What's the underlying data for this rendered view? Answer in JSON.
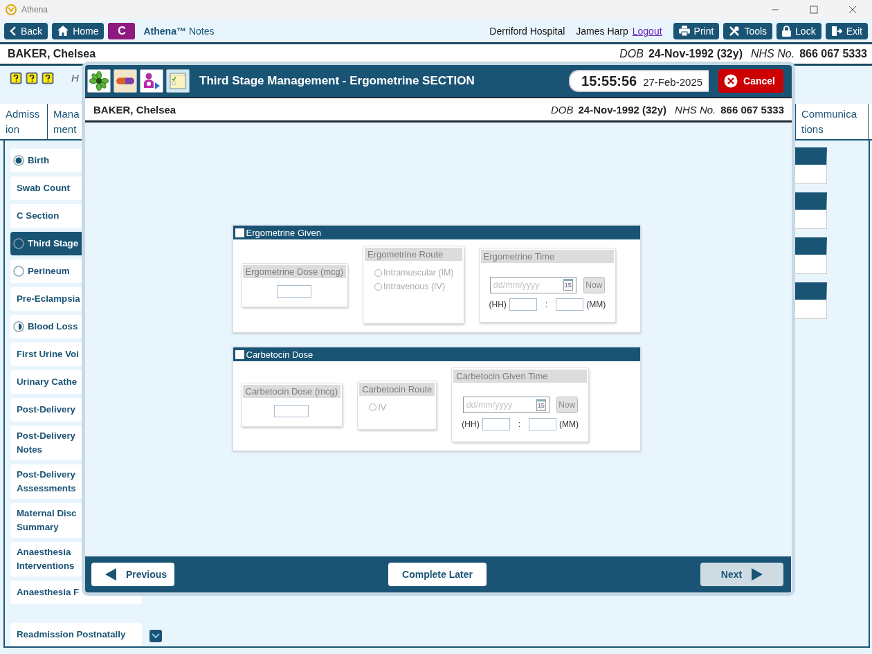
{
  "window": {
    "title": "Athena"
  },
  "toolbar": {
    "nav": [
      {
        "kind": "back",
        "label": "Back"
      },
      {
        "kind": "home",
        "label": "Home"
      }
    ],
    "app_badge": "C",
    "app_name": "Athena™",
    "app_subtitle": "Notes",
    "hospital": "Derriford Hospital",
    "user": "James Harp",
    "logout": "Logout",
    "actions": [
      {
        "kind": "print",
        "label": "Print"
      },
      {
        "kind": "tools",
        "label": "Tools"
      },
      {
        "kind": "lock",
        "label": "Lock"
      },
      {
        "kind": "exit",
        "label": "Exit"
      }
    ]
  },
  "patient": {
    "name": "BAKER, Chelsea",
    "dob_label": "DOB",
    "dob": "24-Nov-1992 (32y)",
    "nhs_label": "NHS No.",
    "nhs": "866 067 5333"
  },
  "info_text": "H",
  "tabs": [
    {
      "lines": [
        "Admiss",
        "ion"
      ],
      "selected": false
    },
    {
      "lines": [
        "Mana",
        "ment"
      ],
      "selected": false
    },
    {
      "lines": [
        "Communica",
        "tions"
      ],
      "selected": false
    }
  ],
  "sidebar": {
    "items": [
      {
        "lines": [
          "Birth"
        ],
        "kind": "complete",
        "selected": false
      },
      {
        "lines": [
          "Swab Count"
        ],
        "kind": "plain",
        "selected": false
      },
      {
        "lines": [
          "C Section"
        ],
        "kind": "plain",
        "selected": false
      },
      {
        "lines": [
          "Third Stage"
        ],
        "kind": "empty",
        "selected": true
      },
      {
        "lines": [
          "Perineum"
        ],
        "kind": "empty",
        "selected": false
      },
      {
        "lines": [
          "Pre-Eclampsia"
        ],
        "kind": "plain",
        "selected": false
      },
      {
        "lines": [
          "Blood Loss"
        ],
        "kind": "partial",
        "selected": false
      },
      {
        "lines": [
          "First Urine Voi"
        ],
        "kind": "plain",
        "selected": false
      },
      {
        "lines": [
          "Urinary Cathe"
        ],
        "kind": "plain",
        "selected": false
      },
      {
        "lines": [
          "Post-Delivery"
        ],
        "kind": "plain",
        "selected": false
      },
      {
        "lines": [
          "Post-Delivery",
          "Notes"
        ],
        "kind": "plain",
        "selected": false
      },
      {
        "lines": [
          "Post-Delivery",
          "Assessments"
        ],
        "kind": "plain",
        "selected": false
      },
      {
        "lines": [
          "Maternal Disc",
          "Summary"
        ],
        "kind": "plain",
        "selected": false
      },
      {
        "lines": [
          "Anaesthesia",
          "Interventions"
        ],
        "kind": "plain",
        "selected": false
      },
      {
        "lines": [
          "Anaesthesia F"
        ],
        "kind": "plain",
        "selected": false
      },
      {
        "lines": [
          "Readmission Postnatally"
        ],
        "kind": "plain",
        "selected": false
      }
    ]
  },
  "modal": {
    "title": "Third Stage Management - Ergometrine SECTION",
    "time": "15:55:56",
    "date": "27-Feb-2025",
    "cancel": "Cancel",
    "patient": {
      "name": "BAKER, Chelsea",
      "dob_label": "DOB",
      "dob": "24-Nov-1992 (32y)",
      "nhs_label": "NHS No.",
      "nhs": "866 067 5333"
    },
    "sections": [
      {
        "title": "Ergometrine Given",
        "checked": false,
        "groups": [
          {
            "kind": "dose",
            "title": "Ergometrine Dose (mcg)",
            "disabled": true
          },
          {
            "kind": "route",
            "title": "Ergometrine Route",
            "disabled": true,
            "options": [
              {
                "label": "Intramuscular (IM)",
                "selected": false
              },
              {
                "label": "Intravenous (IV)",
                "selected": false
              }
            ]
          },
          {
            "kind": "time",
            "title": "Ergometrine Time",
            "disabled": true,
            "date_placeholder": "dd/mm/yyyy",
            "calendar_day": "15",
            "now": "Now",
            "hour_label": "(HH)",
            "separator": ":",
            "minute_label": "(MM)"
          }
        ]
      },
      {
        "title": "Carbetocin Dose",
        "checked": false,
        "groups": [
          {
            "kind": "dose",
            "title": "Carbetocin Dose (mcg)",
            "disabled": true
          },
          {
            "kind": "route",
            "title": "Carbetocin Route",
            "disabled": true,
            "options": [
              {
                "label": "IV",
                "selected": false
              }
            ]
          },
          {
            "kind": "time",
            "title": "Carbetocin Given Time",
            "disabled": true,
            "date_placeholder": "dd/mm/yyyy",
            "calendar_day": "15",
            "now": "Now",
            "hour_label": "(HH)",
            "separator": ":",
            "minute_label": "(MM)"
          }
        ]
      }
    ],
    "buttons": [
      {
        "kind": "previous",
        "label": "Previous",
        "disabled": false
      },
      {
        "kind": "later",
        "label": "Complete Later",
        "disabled": false
      },
      {
        "kind": "next",
        "label": "Next",
        "disabled": true
      }
    ]
  }
}
